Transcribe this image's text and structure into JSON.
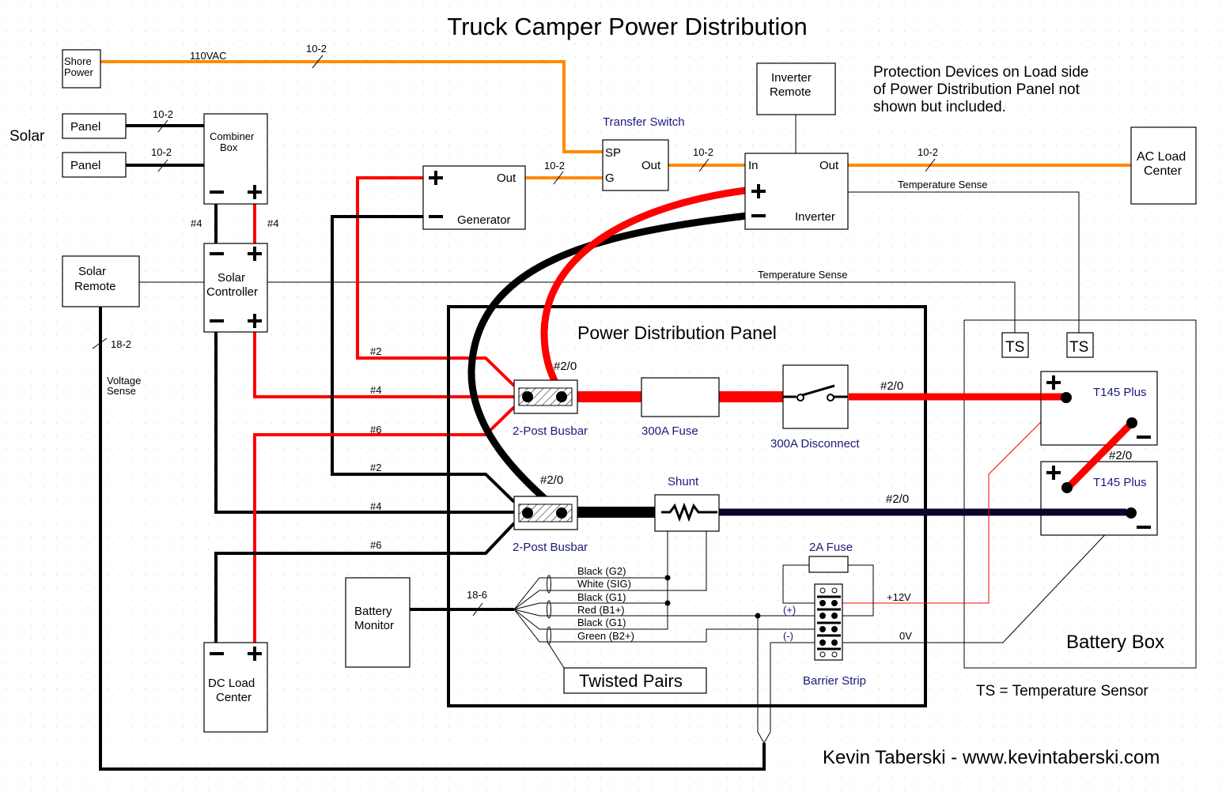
{
  "title": "Truck Camper Power Distribution",
  "note": [
    "Protection Devices on Load side",
    "of Power Distribution Panel not",
    "shown but included."
  ],
  "footer": "Kevin Taberski - www.kevintaberski.com",
  "legend_ts": "TS = Temperature Sensor",
  "colors": {
    "ac_wire": "#ff8a00",
    "positive_wire": "#ff0000",
    "negative_wire": "#000000",
    "battery_negative_wire": "#06062e",
    "label_navy": "#1a1a7a"
  },
  "components": {
    "shore_power": [
      "Shore",
      "Power"
    ],
    "solar_label": "Solar",
    "panel_1": "Panel",
    "panel_2": "Panel",
    "combiner_box": [
      "Combiner",
      "Box"
    ],
    "solar_remote": [
      "Solar",
      "Remote"
    ],
    "solar_controller": [
      "Solar",
      "Controller"
    ],
    "dc_load_center": [
      "DC Load",
      "Center"
    ],
    "generator": "Generator",
    "generator_out": "Out",
    "transfer_switch": "Transfer Switch",
    "ts_sp": "SP",
    "ts_g": "G",
    "ts_out": "Out",
    "inverter_remote": [
      "Inverter",
      "Remote"
    ],
    "inverter": "Inverter",
    "inverter_in": "In",
    "inverter_out": "Out",
    "ac_load_center": [
      "AC Load",
      "Center"
    ],
    "power_distribution_panel": "Power Distribution Panel",
    "busbar_pos": "2-Post Busbar",
    "busbar_neg": "2-Post Busbar",
    "fuse_300a": "300A Fuse",
    "disconnect_300a": "300A Disconnect",
    "shunt": "Shunt",
    "fuse_2a": "2A Fuse",
    "barrier_strip": "Barrier Strip",
    "battery_monitor": [
      "Battery",
      "Monitor"
    ],
    "twisted_pairs": "Twisted Pairs",
    "battery_box": "Battery Box",
    "battery_1": "T145 Plus",
    "battery_2": "T145 Plus",
    "temp_sensor_1": "TS",
    "temp_sensor_2": "TS"
  },
  "wire_labels": {
    "vac110": "110VAC",
    "shore_gauge": "10-2",
    "panel1_gauge": "10-2",
    "panel2_gauge": "10-2",
    "combiner_neg": "#4",
    "combiner_pos": "#4",
    "gen_out_gauge": "10-2",
    "ts_out_gauge": "10-2",
    "inv_out_gauge": "10-2",
    "temp_sense_inverter": "Temperature Sense",
    "temp_sense_controller": "Temperature Sense",
    "remote_gauge": "18-2",
    "voltage_sense": [
      "Voltage",
      "Sense"
    ],
    "pos_bus_2_0": "#2/0",
    "pos_2": "#2",
    "pos_4": "#4",
    "pos_6": "#6",
    "neg_2": "#2",
    "neg_4": "#4",
    "neg_6": "#6",
    "neg_bus_2_0": "#2/0",
    "pos_to_battery": "#2/0",
    "neg_to_battery": "#2/0",
    "battery_jumper": "#2/0",
    "monitor_gauge": "18-6",
    "plus12v": "+12V",
    "zero_v": "0V",
    "plus_term": "(+)",
    "minus_term": "(-)"
  },
  "monitor_wires": [
    "Black (G2)",
    "White (SIG)",
    "Black (G1)",
    "Red (B1+)",
    "Black (G1)",
    "Green (B2+)"
  ],
  "symbols": {
    "plus": "+",
    "minus": "−"
  }
}
